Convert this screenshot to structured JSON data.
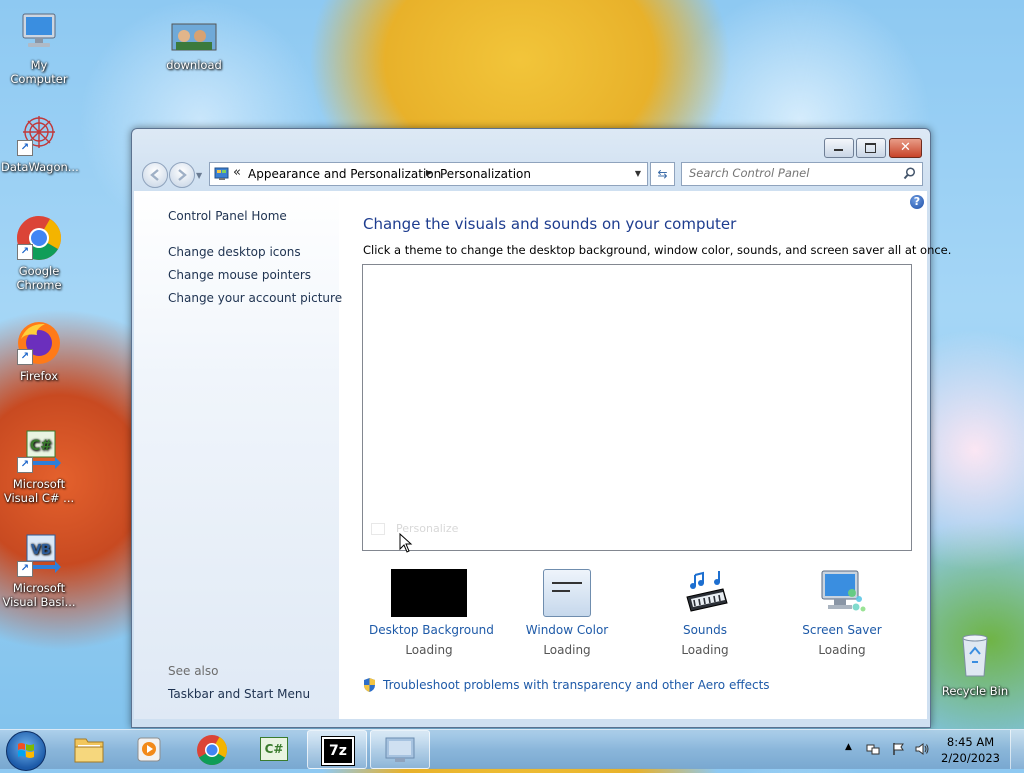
{
  "desktop": {
    "icons": [
      {
        "label": "My Computer"
      },
      {
        "label": "download"
      },
      {
        "label": "DataWagon..."
      },
      {
        "label": "Google Chrome"
      },
      {
        "label": "Firefox"
      },
      {
        "label": "Microsoft Visual C# ..."
      },
      {
        "label": "Microsoft Visual Basi..."
      },
      {
        "label": "Recycle Bin"
      }
    ]
  },
  "window": {
    "breadcrumb": {
      "overflow": "«",
      "items": [
        "Appearance and Personalization",
        "Personalization"
      ]
    },
    "search": {
      "placeholder": "Search Control Panel"
    },
    "left_pane": {
      "home": "Control Panel Home",
      "links": [
        "Change desktop icons",
        "Change mouse pointers",
        "Change your account picture"
      ],
      "see_also_label": "See also",
      "see_also_links": [
        "Taskbar and Start Menu"
      ]
    },
    "main": {
      "heading": "Change the visuals and sounds on your computer",
      "subtitle": "Click a theme to change the desktop background, window color, sounds, and screen saver all at once.",
      "ghost_text": "Personalize",
      "settings": [
        {
          "label": "Desktop Background",
          "status": "Loading"
        },
        {
          "label": "Window Color",
          "status": "Loading"
        },
        {
          "label": "Sounds",
          "status": "Loading"
        },
        {
          "label": "Screen Saver",
          "status": "Loading"
        }
      ],
      "troubleshoot_link": "Troubleshoot problems with transparency and other Aero effects"
    }
  },
  "taskbar": {
    "apps": [
      "start",
      "explorer",
      "media-player",
      "chrome",
      "visual-csharp",
      "7-zip",
      "control-panel"
    ],
    "app_7zip_text": "7z",
    "csharp_text": "C#",
    "clock": {
      "time": "8:45 AM",
      "date": "2/20/2023"
    }
  },
  "colors": {
    "link": "#1e5aa8",
    "heading": "#1e3d8f"
  }
}
